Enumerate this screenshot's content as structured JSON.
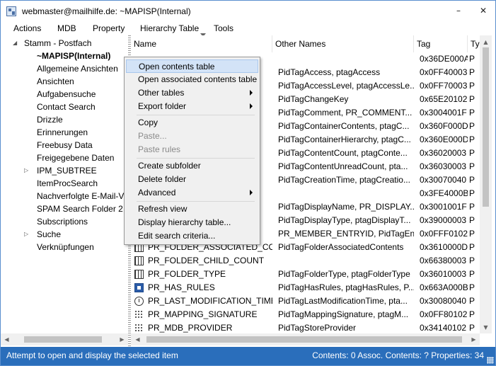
{
  "title": "webmaster@mailhilfe.de: ~MAPISP(Internal)",
  "window_controls": {
    "minimize": "–",
    "close": "✕"
  },
  "menu": [
    "Actions",
    "MDB",
    "Property",
    "Hierarchy Table",
    "Tools"
  ],
  "tree": [
    {
      "label": "Stamm - Postfach",
      "expander": "◢"
    },
    {
      "label": "~MAPISP(Internal)",
      "selected": true
    },
    {
      "label": "Allgemeine Ansichten"
    },
    {
      "label": "Ansichten"
    },
    {
      "label": "Aufgabensuche"
    },
    {
      "label": "Contact Search"
    },
    {
      "label": "Drizzle"
    },
    {
      "label": "Erinnerungen"
    },
    {
      "label": "Freebusy Data"
    },
    {
      "label": "Freigegebene Daten"
    },
    {
      "label": "IPM_SUBTREE",
      "expander": "▷"
    },
    {
      "label": "ItemProcSearch"
    },
    {
      "label": "Nachverfolgte E-Mail-V"
    },
    {
      "label": "SPAM Search Folder 2"
    },
    {
      "label": "Subscriptions"
    },
    {
      "label": "Suche",
      "expander": "▷"
    },
    {
      "label": "Verknüpfungen"
    }
  ],
  "columns": [
    "Name",
    "Other Names",
    "Tag",
    "Ty"
  ],
  "rows": [
    {
      "name": "",
      "other": "",
      "tag": "0x36DE000A",
      "type": "P"
    },
    {
      "name": "",
      "other": "PidTagAccess, ptagAccess",
      "tag": "0x0FF40003",
      "type": "P"
    },
    {
      "name": "",
      "other": "PidTagAccessLevel, ptagAccessLe...",
      "tag": "0x0FF70003",
      "type": "P"
    },
    {
      "name": "",
      "other": "PidTagChangeKey",
      "tag": "0x65E20102",
      "type": "P"
    },
    {
      "name": "",
      "other": "PidTagComment, PR_COMMENT...",
      "tag": "0x3004001F",
      "type": "P"
    },
    {
      "name": "",
      "other": "PidTagContainerContents, ptagC...",
      "tag": "0x360F000D",
      "type": "P"
    },
    {
      "name": "",
      "other": "PidTagContainerHierarchy, ptagC...",
      "tag": "0x360E000D",
      "type": "P"
    },
    {
      "name": "",
      "other": "PidTagContentCount, ptagConte...",
      "tag": "0x36020003",
      "type": "P"
    },
    {
      "name": "",
      "other": "PidTagContentUnreadCount, pta...",
      "tag": "0x36030003",
      "type": "P"
    },
    {
      "name": "",
      "other": "PidTagCreationTime, ptagCreatio...",
      "tag": "0x30070040",
      "type": "P"
    },
    {
      "name": "",
      "other": "",
      "tag": "0x3FE4000B",
      "type": "P"
    },
    {
      "name": "",
      "other": "PidTagDisplayName, PR_DISPLAY...",
      "tag": "0x3001001F",
      "type": "P"
    },
    {
      "name": "",
      "other": "PidTagDisplayType, ptagDisplayT...",
      "tag": "0x39000003",
      "type": "P"
    },
    {
      "name": "",
      "other": "PR_MEMBER_ENTRYID, PidTagEnt...",
      "tag": "0x0FFF0102",
      "type": "P"
    },
    {
      "name": "PR_FOLDER_ASSOCIATED_CON...",
      "other": "PidTagFolderAssociatedContents",
      "tag": "0x3610000D",
      "type": "P",
      "icon": "grid"
    },
    {
      "name": "PR_FOLDER_CHILD_COUNT",
      "other": "",
      "tag": "0x66380003",
      "type": "P",
      "icon": "grid"
    },
    {
      "name": "PR_FOLDER_TYPE",
      "other": "PidTagFolderType, ptagFolderType",
      "tag": "0x36010003",
      "type": "P",
      "icon": "grid"
    },
    {
      "name": "PR_HAS_RULES",
      "other": "PidTagHasRules, ptagHasRules, P...",
      "tag": "0x663A000B",
      "type": "P",
      "icon": "blue"
    },
    {
      "name": "PR_LAST_MODIFICATION_TIME",
      "other": "PidTagLastModificationTime, pta...",
      "tag": "0x30080040",
      "type": "P",
      "icon": "clock"
    },
    {
      "name": "PR_MAPPING_SIGNATURE",
      "other": "PidTagMappingSignature, ptagM...",
      "tag": "0x0FF80102",
      "type": "P",
      "icon": "dots"
    },
    {
      "name": "PR_MDB_PROVIDER",
      "other": "PidTagStoreProvider",
      "tag": "0x34140102",
      "type": "P",
      "icon": "dots"
    }
  ],
  "context_menu": [
    {
      "label": "Open contents table",
      "selected": true
    },
    {
      "label": "Open associated contents table"
    },
    {
      "label": "Other tables",
      "submenu": true
    },
    {
      "label": "Export folder",
      "submenu": true,
      "sep_after": true
    },
    {
      "label": "Copy"
    },
    {
      "label": "Paste...",
      "disabled": true
    },
    {
      "label": "Paste rules",
      "disabled": true,
      "sep_after": true
    },
    {
      "label": "Create subfolder"
    },
    {
      "label": "Delete folder"
    },
    {
      "label": "Advanced",
      "submenu": true,
      "sep_after": true
    },
    {
      "label": "Refresh view"
    },
    {
      "label": "Display hierarchy table..."
    },
    {
      "label": "Edit search criteria..."
    }
  ],
  "scroll_arrows": {
    "left": "◀",
    "right": "▶",
    "up": "▲",
    "down": "▼"
  },
  "status": {
    "left": "Attempt to open and display the selected item",
    "right": "Contents: 0 Assoc. Contents: ?  Properties: 34"
  }
}
